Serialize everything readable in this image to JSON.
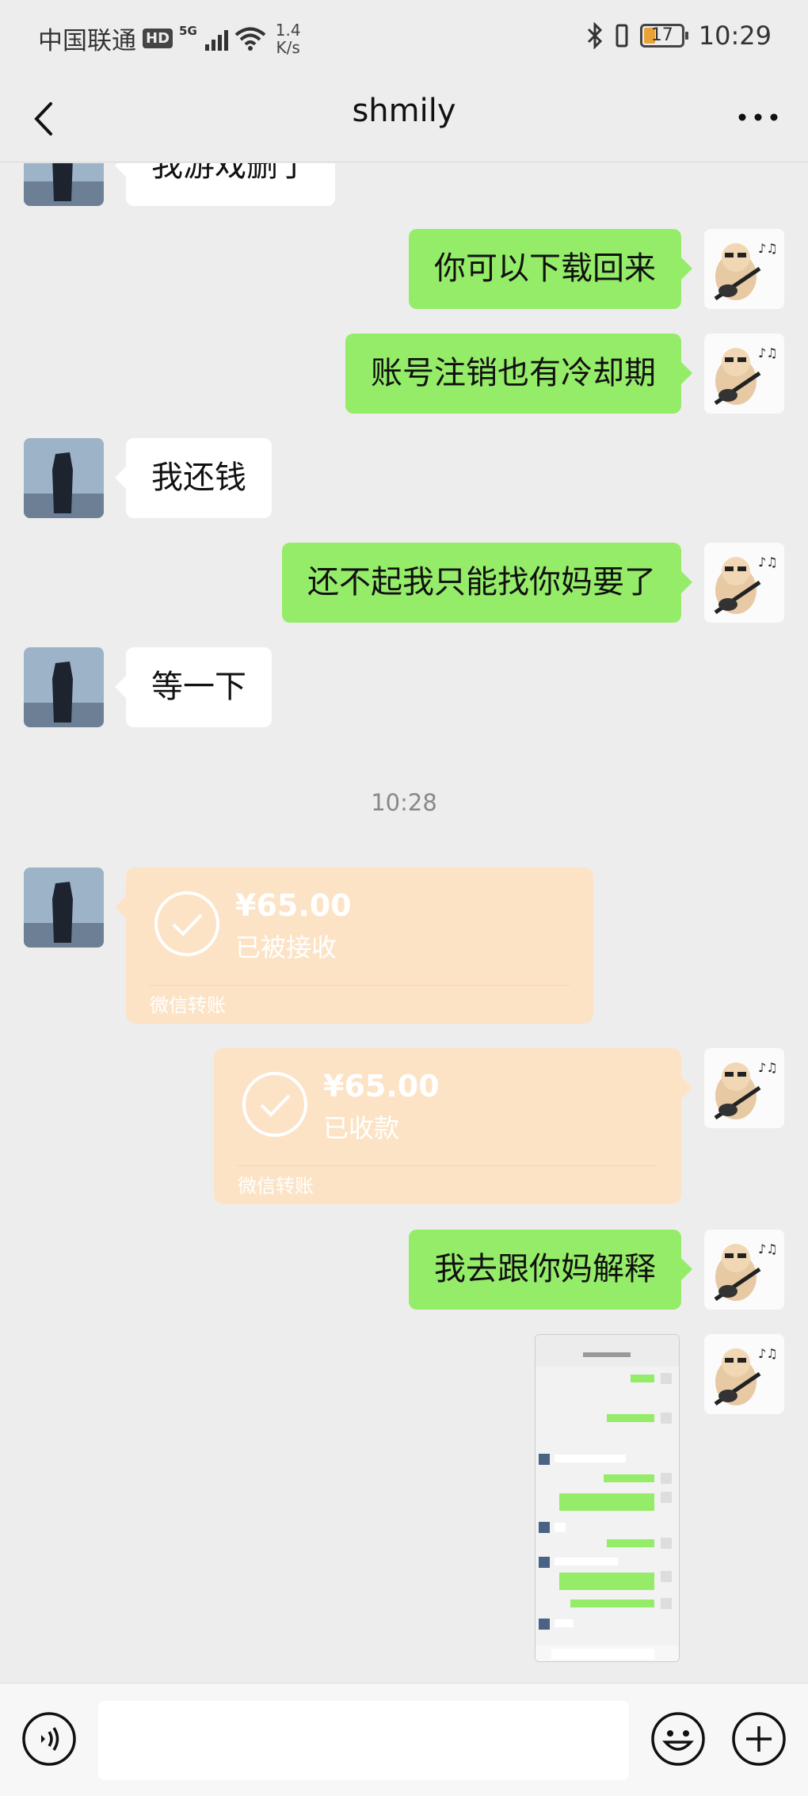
{
  "status_bar": {
    "carrier": "中国联通",
    "hd": "HD",
    "network": "5G",
    "speed_value": "1.4",
    "speed_unit": "K/s",
    "battery": "17",
    "time": "10:29"
  },
  "nav": {
    "title": "shmily"
  },
  "messages": [
    {
      "side": "in",
      "text": "我游戏删了"
    },
    {
      "side": "out",
      "text": "你可以下载回来"
    },
    {
      "side": "out",
      "text": "账号注销也有冷却期"
    },
    {
      "side": "in",
      "text": "我还钱"
    },
    {
      "side": "out",
      "text": "还不起我只能找你妈要了"
    },
    {
      "side": "in",
      "text": "等一下"
    }
  ],
  "timestamp": "10:28",
  "transfers": [
    {
      "side": "in",
      "amount": "¥65.00",
      "status": "已被接收",
      "footer": "微信转账"
    },
    {
      "side": "out",
      "amount": "¥65.00",
      "status": "已收款",
      "footer": "微信转账"
    }
  ],
  "last_message": {
    "side": "out",
    "text": "我去跟你妈解释"
  },
  "colors": {
    "background": "#ededed",
    "outgoing_bubble": "#95ec69",
    "incoming_bubble": "#ffffff",
    "transfer_card": "#fce3c6"
  },
  "icons": {
    "back": "chevron-left-icon",
    "more": "more-dots-icon",
    "voice": "voice-icon",
    "emoji": "emoji-icon",
    "plus": "plus-icon"
  }
}
